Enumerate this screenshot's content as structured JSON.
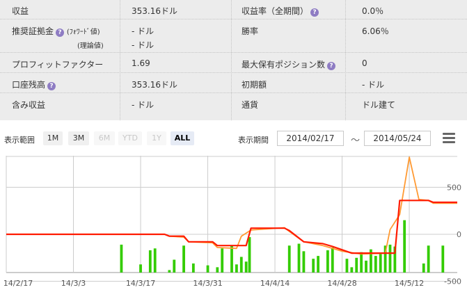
{
  "stats": {
    "rows": [
      {
        "left_label": "収益",
        "left_value": "353.16ドル",
        "right_label": "収益率（全期間）",
        "right_help": true,
        "right_value": "0.0％"
      },
      {
        "left_label": "推奨証拠金",
        "left_help": true,
        "left_sub1": "(ﾌｫﾜｰﾄﾞ値)",
        "left_sub2": "(理論値)",
        "left_value": "- ドル",
        "left_value2": "- ドル",
        "right_label": "勝率",
        "right_value": "6.06％"
      },
      {
        "left_label": "プロフィットファクター",
        "left_value": "1.69",
        "right_label": "最大保有ポジション数",
        "right_help": true,
        "right_value": "0"
      },
      {
        "left_label": "口座残高",
        "left_help": true,
        "left_value": "353.16ドル",
        "right_label": "初期額",
        "right_value": "- ドル"
      },
      {
        "left_label": "含み収益",
        "left_value": "- ドル",
        "right_label": "通貨",
        "right_value": "ドル建て"
      }
    ],
    "help_glyph": "?"
  },
  "range": {
    "label": "表示範囲",
    "buttons": [
      {
        "label": "1M",
        "state": "normal"
      },
      {
        "label": "3M",
        "state": "normal"
      },
      {
        "label": "6M",
        "state": "disabled"
      },
      {
        "label": "YTD",
        "state": "disabled"
      },
      {
        "label": "1Y",
        "state": "disabled"
      },
      {
        "label": "ALL",
        "state": "active"
      }
    ],
    "period_label": "表示期間",
    "from": "2014/02/17",
    "separator": "～",
    "to": "2014/05/24",
    "menu_icon": "hamburger-menu-icon"
  },
  "chart_data": {
    "type": "line",
    "x_ticks": [
      "14/2/17",
      "14/3/3",
      "14/3/17",
      "14/3/31",
      "14/4/14",
      "14/4/28",
      "14/5/12"
    ],
    "y_ticks": [
      "500",
      "0",
      "-500"
    ],
    "ylim": [
      -500,
      820
    ],
    "colors": {
      "balance": "#ff1a00",
      "equity": "#ff9a33",
      "bars": "#33cc00",
      "grid": "#cccccc"
    },
    "series": [
      {
        "key": "balance",
        "values": [
          [
            0,
            0
          ],
          [
            33,
            0
          ],
          [
            34,
            -20
          ],
          [
            37,
            -20
          ],
          [
            38,
            -80
          ],
          [
            43,
            -80
          ],
          [
            44,
            -120
          ],
          [
            50,
            -120
          ],
          [
            51,
            65
          ],
          [
            58,
            65
          ],
          [
            59,
            40
          ],
          [
            62,
            -80
          ],
          [
            66,
            -100
          ],
          [
            68,
            -130
          ],
          [
            72,
            -200
          ],
          [
            81,
            -200
          ],
          [
            82,
            360
          ],
          [
            88,
            360
          ],
          [
            89,
            340
          ],
          [
            94,
            340
          ]
        ]
      },
      {
        "key": "equity",
        "values": [
          [
            0,
            0
          ],
          [
            33,
            0
          ],
          [
            34,
            -20
          ],
          [
            37,
            -30
          ],
          [
            38,
            -80
          ],
          [
            43,
            -90
          ],
          [
            44,
            -140
          ],
          [
            48,
            -150
          ],
          [
            49,
            -20
          ],
          [
            51,
            45
          ],
          [
            58,
            70
          ],
          [
            59,
            30
          ],
          [
            62,
            -80
          ],
          [
            66,
            -120
          ],
          [
            70,
            -180
          ],
          [
            74,
            -210
          ],
          [
            79,
            -200
          ],
          [
            80,
            50
          ],
          [
            82,
            210
          ],
          [
            84,
            820
          ],
          [
            86,
            370
          ],
          [
            88,
            360
          ],
          [
            89,
            330
          ],
          [
            94,
            330
          ]
        ]
      },
      {
        "key": "bars",
        "values": [
          [
            24,
            -110
          ],
          [
            28,
            -320
          ],
          [
            30,
            -170
          ],
          [
            31,
            -150
          ],
          [
            34,
            -380
          ],
          [
            35,
            -270
          ],
          [
            37,
            -120
          ],
          [
            39,
            -310
          ],
          [
            42,
            -330
          ],
          [
            44,
            -350
          ],
          [
            45,
            -150
          ],
          [
            47,
            -120
          ],
          [
            48,
            -320
          ],
          [
            49,
            -240
          ],
          [
            50,
            -290
          ],
          [
            50.7,
            -30
          ],
          [
            59,
            -120
          ],
          [
            61,
            -100
          ],
          [
            62,
            -180
          ],
          [
            64,
            -260
          ],
          [
            65,
            -230
          ],
          [
            67,
            -170
          ],
          [
            68,
            -140
          ],
          [
            71,
            -260
          ],
          [
            72,
            -350
          ],
          [
            73,
            -250
          ],
          [
            74,
            -190
          ],
          [
            75,
            -280
          ],
          [
            76,
            -160
          ],
          [
            77,
            -230
          ],
          [
            78,
            -210
          ],
          [
            79,
            -120
          ],
          [
            80,
            -110
          ],
          [
            81,
            -130
          ],
          [
            83,
            150
          ],
          [
            87,
            -310
          ],
          [
            88,
            -120
          ],
          [
            91,
            -120
          ]
        ]
      }
    ]
  }
}
